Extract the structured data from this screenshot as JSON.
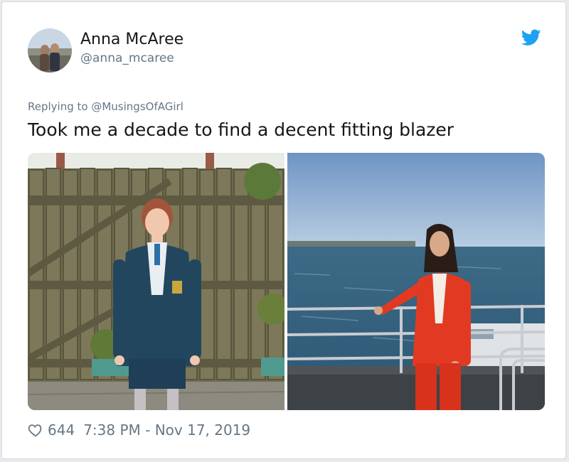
{
  "tweet": {
    "author_name": "Anna McAree",
    "author_handle": "@anna_mcaree",
    "reply_prefix": "Replying to",
    "reply_to": "@MusingsOfAGirl",
    "text": "Took me a decade to find a decent fitting blazer",
    "likes": "644",
    "timestamp": "7:38 PM - Nov 17, 2019"
  },
  "icons": {
    "brand": "twitter-bird-icon",
    "like": "heart-outline-icon"
  },
  "colors": {
    "twitter_blue": "#1da1f2",
    "secondary_text": "#657786",
    "primary_text": "#14171a"
  }
}
